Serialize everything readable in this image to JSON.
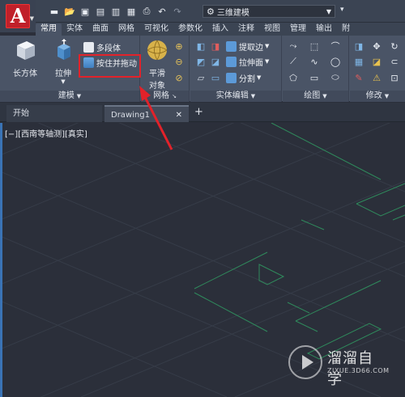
{
  "titlebar": {
    "workspace": "三维建模"
  },
  "ribbon_tabs": [
    "常用",
    "实体",
    "曲面",
    "网格",
    "可视化",
    "参数化",
    "插入",
    "注释",
    "视图",
    "管理",
    "输出",
    "附"
  ],
  "panels": {
    "modeling": {
      "title": "建模",
      "box_label": "长方体",
      "extrude_label": "拉伸",
      "polysolid_label": "多段体",
      "presspull_label": "按住并拖动"
    },
    "mesh": {
      "title": "网格",
      "smooth_line1": "平滑",
      "smooth_line2": "对象"
    },
    "solid_editing": {
      "title": "实体编辑",
      "extract_edges": "提取边",
      "extrude_faces": "拉伸面",
      "slice": "分割"
    },
    "draw": {
      "title": "绘图"
    },
    "modify": {
      "title": "修改"
    }
  },
  "doc_tabs": {
    "start": "开始",
    "drawing": "Drawing1",
    "close": "✕",
    "new": "+"
  },
  "viewport": {
    "label": "[−][西南等轴测][真实]"
  },
  "watermark": {
    "name": "溜溜自学",
    "url": "ZIXUE.3D66.COM"
  },
  "colors": {
    "grid": "#363c48",
    "green_lines": "#2e7f57",
    "arrow": "#e2222a",
    "app_logo": "#c0202a"
  }
}
